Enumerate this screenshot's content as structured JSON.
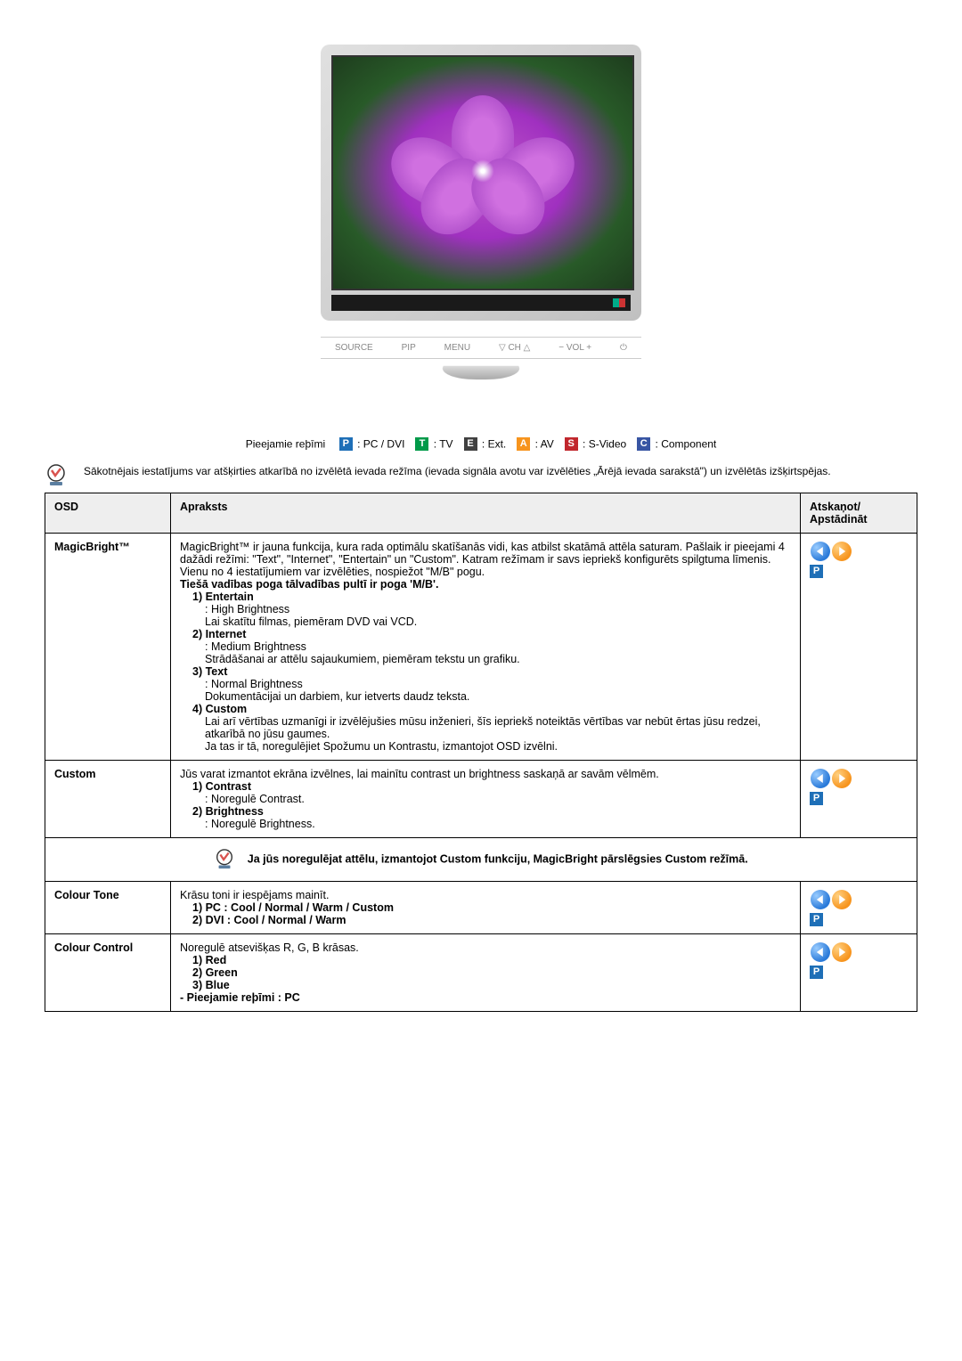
{
  "monitor_controls": [
    "SOURCE",
    "PIP",
    "MENU",
    "CH",
    "VOL",
    "⏻"
  ],
  "modes_label": "Pieejamie reþīmi",
  "modes": [
    {
      "letter": "P",
      "color": "#1e6fb7",
      "label": ": PC / DVI"
    },
    {
      "letter": "T",
      "color": "#009a49",
      "label": ": TV"
    },
    {
      "letter": "E",
      "color": "#404040",
      "label": ": Ext."
    },
    {
      "letter": "A",
      "color": "#f7941d",
      "label": ": AV"
    },
    {
      "letter": "S",
      "color": "#c1272d",
      "label": ": S-Video"
    },
    {
      "letter": "C",
      "color": "#3855a3",
      "label": ": Component"
    }
  ],
  "top_note": "Sākotnējais iestatījums var atšķirties atkarībā no izvēlētā ievada režīma (ievada signāla avotu var izvēlēties „Ārējā ievada sarakstā\") un izvēlētās izšķirtspējas.",
  "headers": {
    "osd": "OSD",
    "desc": "Apraksts",
    "action": "Atskaņot/\nApstādināt"
  },
  "rows": {
    "magicbright": {
      "osd": "MagicBright™",
      "intro": "MagicBright™ ir jauna funkcija, kura rada optimālu skatīšanās vidi, kas atbilst skatāmā attēla saturam. Pašlaik ir pieejami 4 dažādi režīmi: \"Text\", \"Internet\", \"Entertain\" un \"Custom\". Katram režīmam ir savs iepriekš konfigurēts spilgtuma līmenis. Vienu no 4 iestatījumiem var izvēlēties, nospiežot \"M/B\" pogu.",
      "direct": "Tiešā vadības poga tālvadības pultī ir poga 'M/B'.",
      "i1_t": "1) Entertain",
      "i1_a": ": High Brightness",
      "i1_b": "Lai skatītu filmas, piemēram DVD vai VCD.",
      "i2_t": "2) Internet",
      "i2_a": ": Medium Brightness",
      "i2_b": "Strādāšanai ar attēlu sajaukumiem, piemēram tekstu un grafiku.",
      "i3_t": "3) Text",
      "i3_a": ": Normal Brightness",
      "i3_b": "Dokumentācijai un darbiem, kur ietverts daudz teksta.",
      "i4_t": "4) Custom",
      "i4_a": "Lai arī vērtības uzmanīgi ir izvēlējušies mūsu inženieri, šīs iepriekš noteiktās vērtības var nebūt ērtas jūsu redzei, atkarībā no jūsu gaumes.",
      "i4_b": "Ja tas ir tā, noregulējiet Spožumu un Kontrastu, izmantojot OSD izvēlni."
    },
    "custom": {
      "osd": "Custom",
      "intro": "Jūs varat izmantot ekrāna izvēlnes, lai mainītu contrast un brightness saskaņā ar savām vēlmēm.",
      "i1_t": "1) Contrast",
      "i1_a": ": Noregulē Contrast.",
      "i2_t": "2) Brightness",
      "i2_a": ": Noregulē Brightness."
    },
    "mid_note": "Ja jūs noregulējat attēlu, izmantojot Custom funkciju, MagicBright pārslēgsies Custom režīmā.",
    "colour_tone": {
      "osd": "Colour Tone",
      "intro": "Krāsu toni ir iespējams mainīt.",
      "i1": "1) PC : Cool / Normal / Warm / Custom",
      "i2": "2) DVI : Cool / Normal / Warm"
    },
    "colour_control": {
      "osd": "Colour Control",
      "intro": "Noregulē atsevišķas R, G, B krāsas.",
      "i1": "1) Red",
      "i2": "2) Green",
      "i3": "3) Blue",
      "foot": "- Pieejamie reþīmi : PC"
    }
  },
  "p_label": "P"
}
